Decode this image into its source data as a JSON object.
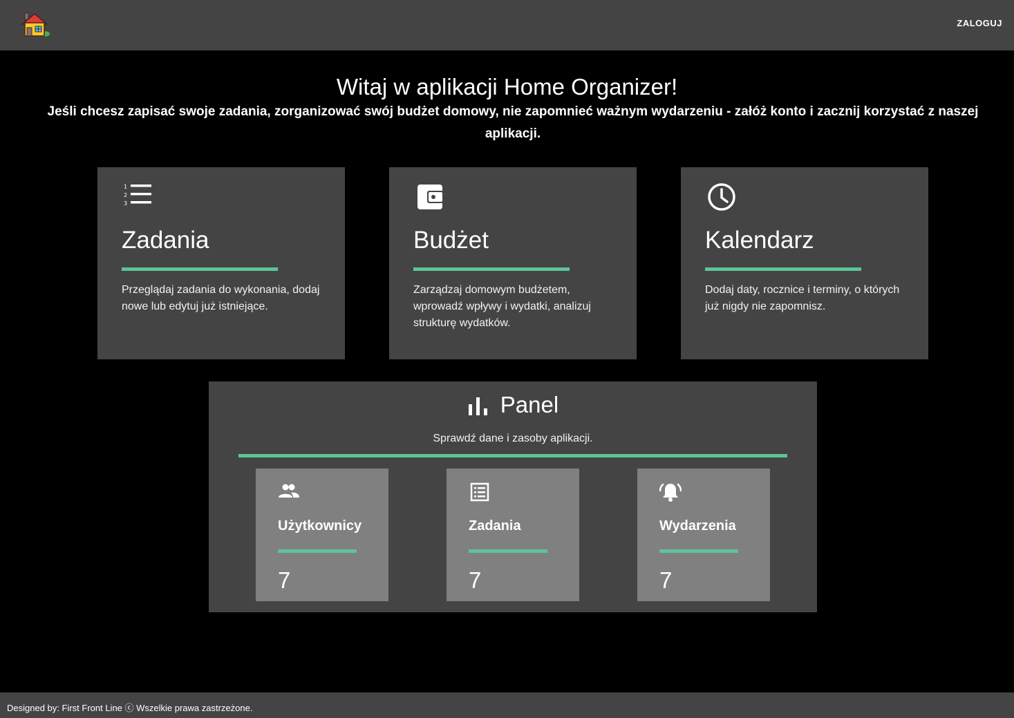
{
  "header": {
    "logo_icon": "house-icon",
    "login_label": "ZALOGUJ"
  },
  "hero": {
    "title": "Witaj w aplikacji Home Organizer!",
    "subtitle": "Jeśli chcesz zapisać swoje zadania, zorganizować swój budżet domowy, nie zapomnieć ważnym wydarzeniu - załóż konto i zacznij korzystać z naszej aplikacji."
  },
  "cards": [
    {
      "icon": "numbered-list-icon",
      "title": "Zadania",
      "description": "Przeglądaj zadania do wykonania, dodaj nowe lub edytuj już istniejące."
    },
    {
      "icon": "wallet-icon",
      "title": "Budżet",
      "description": "Zarządzaj domowym budżetem, wprowadź wpływy i wydatki, analizuj strukturę wydatków."
    },
    {
      "icon": "clock-icon",
      "title": "Kalendarz",
      "description": "Dodaj daty, rocznice i terminy, o których już nigdy nie zapomnisz."
    }
  ],
  "panel": {
    "icon": "bar-chart-icon",
    "title": "Panel",
    "subtitle": "Sprawdź dane i zasoby aplikacji.",
    "stats": [
      {
        "icon": "people-icon",
        "title": "Użytkownicy",
        "value": "7"
      },
      {
        "icon": "list-box-icon",
        "title": "Zadania",
        "value": "7"
      },
      {
        "icon": "alarm-bell-icon",
        "title": "Wydarzenia",
        "value": "7"
      }
    ]
  },
  "footer": {
    "text": "Designed by: First Front Line ⓒ Wszelkie prawa zastrzeżone."
  },
  "colors": {
    "background": "#000000",
    "surface": "#444444",
    "stat_surface": "#808080",
    "accent": "#5ec49a"
  }
}
